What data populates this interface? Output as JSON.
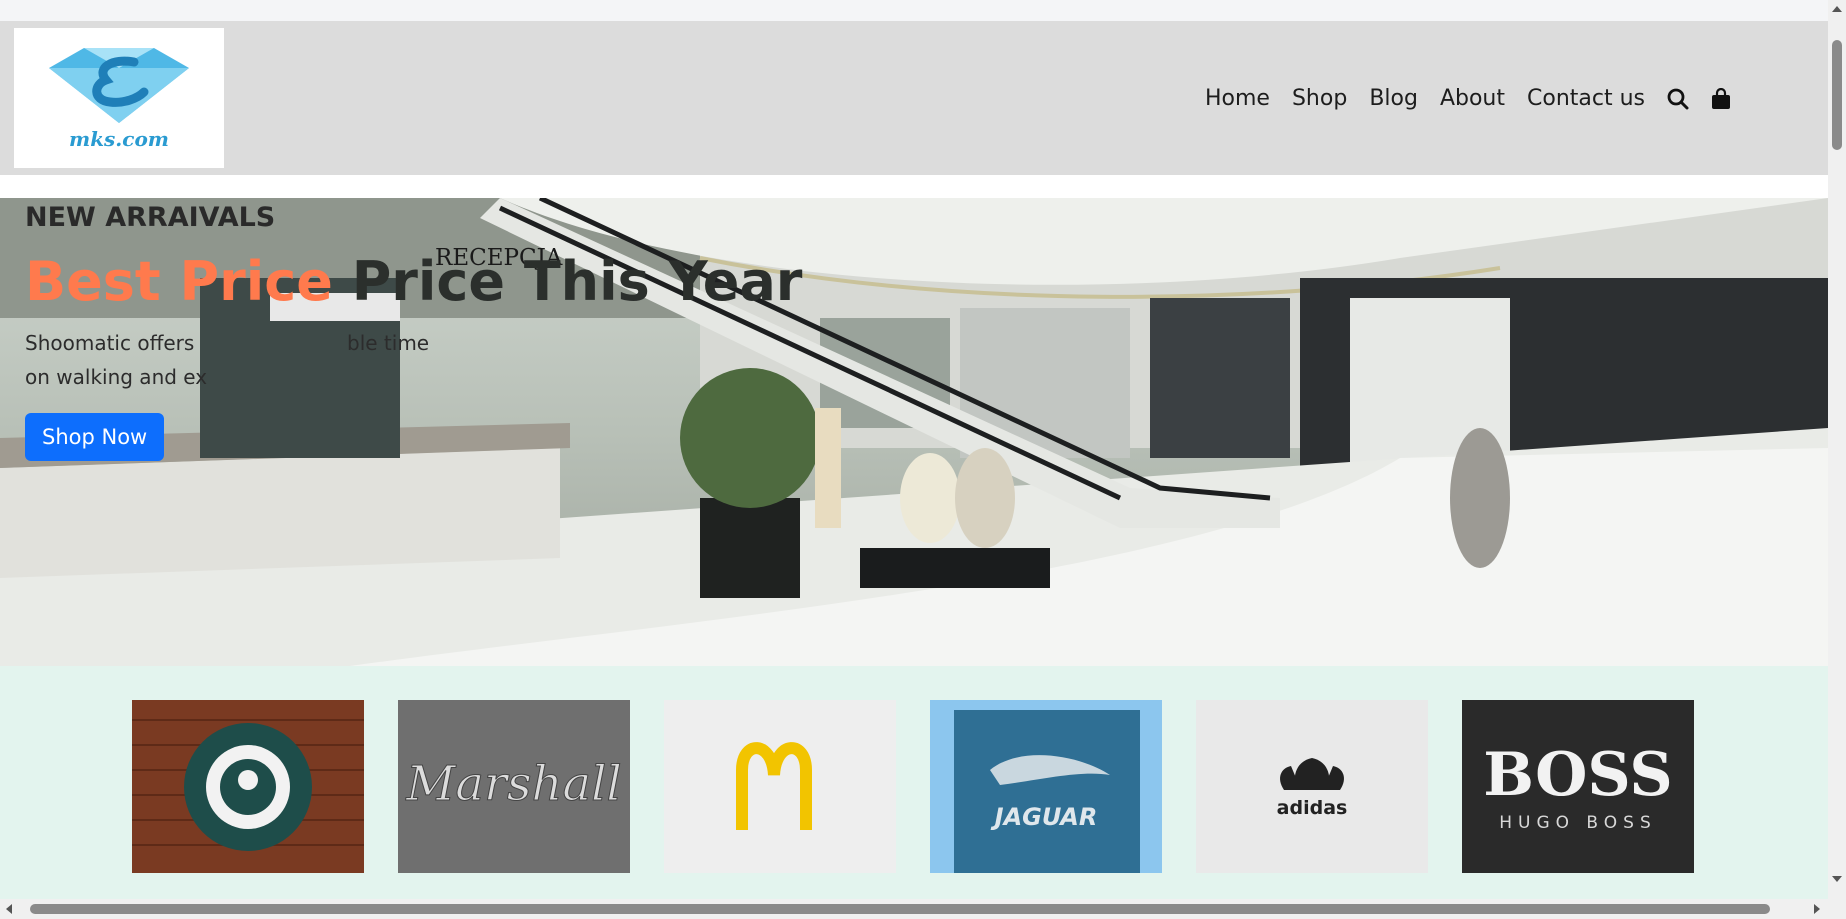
{
  "logo": {
    "text": "mks.com"
  },
  "nav": {
    "items": [
      "Home",
      "Shop",
      "Blog",
      "About",
      "Contact us"
    ],
    "search_icon": "search-icon",
    "cart_icon": "shopping-bag-icon"
  },
  "hero": {
    "kicker": "NEW ARRAIVALS",
    "headline_accent": "Best Price",
    "headline_rest": " Price This Year",
    "sub_line1": "Shoomatic offers",
    "sub_line1_end": "ble time",
    "sub_line2": "on walking and ex",
    "sign_text": "RECEPCJA",
    "button_label": "Shop Now",
    "colors": {
      "accent": "#ff7a4d",
      "button": "#0d6efd"
    }
  },
  "brands": {
    "items": [
      {
        "name": "starbucks",
        "text": ""
      },
      {
        "name": "marshall",
        "text": "Marshall"
      },
      {
        "name": "mcdonalds",
        "text": "M"
      },
      {
        "name": "jaguar",
        "text": "JAGUAR"
      },
      {
        "name": "adidas",
        "text": "adidas"
      },
      {
        "name": "boss",
        "text": "BOSS",
        "subtext": "HUGO BOSS"
      }
    ]
  }
}
